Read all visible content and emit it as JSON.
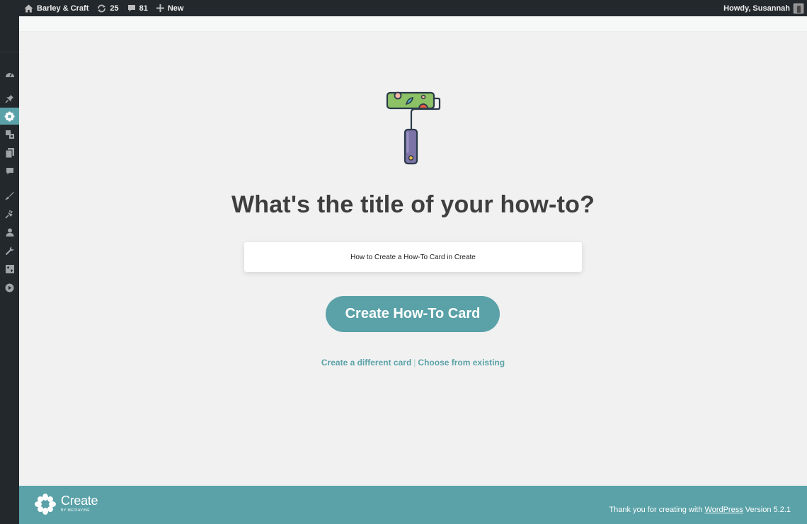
{
  "adminbar": {
    "site_name": "Barley & Craft",
    "updates_count": "25",
    "comments_count": "81",
    "new_label": "New",
    "greeting": "Howdy, Susannah"
  },
  "sidebar": {
    "items": [
      {
        "icon": "dashboard-icon"
      },
      {
        "icon": "pin-icon"
      },
      {
        "icon": "create-flower-icon",
        "active": true
      },
      {
        "icon": "media-icon"
      },
      {
        "icon": "pages-icon"
      },
      {
        "icon": "comments-icon"
      },
      {
        "icon": "appearance-icon"
      },
      {
        "icon": "plugins-icon"
      },
      {
        "icon": "users-icon"
      },
      {
        "icon": "tools-icon"
      },
      {
        "icon": "settings-icon"
      },
      {
        "icon": "media-play-icon"
      }
    ]
  },
  "main": {
    "heading": "What's the title of your how-to?",
    "title_input_value": "How to Create a How-To Card in Create",
    "create_button_label": "Create How-To Card",
    "different_card_link": "Create a different card",
    "separator": "|",
    "choose_existing_link": "Choose from existing"
  },
  "footer": {
    "logo_name": "Create",
    "logo_byline": "BY MEDIAVINE",
    "thanks_prefix": "Thank you for creating with",
    "wordpress_link": "WordPress",
    "version": "Version 5.2.1"
  },
  "colors": {
    "accent": "#5aa2a8",
    "admin_bar": "#23282d",
    "heading": "#3e3e3e",
    "background": "#f1f1f1"
  }
}
